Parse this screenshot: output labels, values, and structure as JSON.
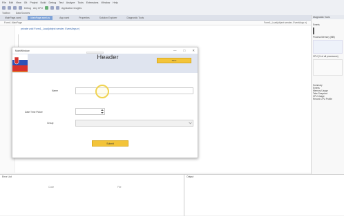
{
  "menu": [
    "File",
    "Edit",
    "View",
    "Git",
    "Project",
    "Build",
    "Debug",
    "Test",
    "Analyze",
    "Tools",
    "Extensions",
    "Window",
    "Help"
  ],
  "toolbar_texts": [
    "Debug",
    "Any CPU",
    "Application Insights"
  ],
  "row3": [
    "Toolbox",
    "Data Sources"
  ],
  "tabs": [
    "MainPage.xaml",
    "MainPage.xaml.cs",
    "App.xaml",
    "Properties",
    "Solution Explorer",
    "Diagnostic Tools"
  ],
  "crumb": {
    "left": "Form1.MainPage",
    "right": "Form1_Load(object sender, EventArgs e)"
  },
  "code_line": "private void Form1_Load(object sender, EventArgs e)",
  "right_panel": {
    "title": "Diagnostic Tools",
    "labels": [
      "Events",
      "Process Memory (MB)",
      "CPU (% of all processors)",
      "Summary",
      "Events",
      "Memory Usage",
      "Take Snapshot",
      "CPU Usage",
      "Record CPU Profile"
    ]
  },
  "bottom": {
    "left_title": "Error List",
    "right_title": "Output",
    "col1": "Code",
    "col2": "File"
  },
  "dialog": {
    "title": "MainWindow",
    "controls": [
      "—",
      "□",
      "✕"
    ],
    "header": "Header",
    "header_button": "Save",
    "fields": {
      "name_label": "Name",
      "date_label": "Date Time Picker",
      "group_label": "Group"
    },
    "submit": "Submit"
  }
}
